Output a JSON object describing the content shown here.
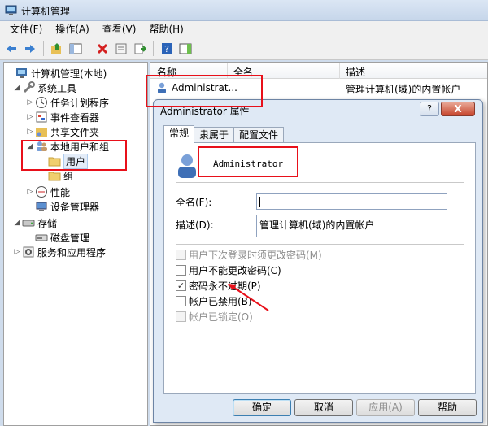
{
  "window": {
    "title": "计算机管理"
  },
  "menu": [
    "文件(F)",
    "操作(A)",
    "查看(V)",
    "帮助(H)"
  ],
  "tree": {
    "root": "计算机管理(本地)",
    "system_tools": "系统工具",
    "task_scheduler": "任务计划程序",
    "event_viewer": "事件查看器",
    "shared_folders": "共享文件夹",
    "local_users_groups": "本地用户和组",
    "users": "用户",
    "groups": "组",
    "performance": "性能",
    "device_manager": "设备管理器",
    "storage": "存储",
    "disk_management": "磁盘管理",
    "services_apps": "服务和应用程序"
  },
  "list": {
    "columns": [
      "名称",
      "全名",
      "描述"
    ],
    "row": {
      "name": "Administrat...",
      "desc": "管理计算机(域)的内置帐户"
    }
  },
  "dialog": {
    "title": "Administrator 属性",
    "help": "?",
    "close": "X",
    "tabs": [
      "常规",
      "隶属于",
      "配置文件"
    ],
    "username": "Administrator",
    "full_name_label": "全名(F):",
    "full_name_value": "",
    "description_label": "描述(D):",
    "description_value": "管理计算机(域)的内置帐户",
    "options": [
      {
        "label": "用户下次登录时须更改密码(M)",
        "checked": false,
        "disabled": true
      },
      {
        "label": "用户不能更改密码(C)",
        "checked": false,
        "disabled": false
      },
      {
        "label": "密码永不过期(P)",
        "checked": true,
        "disabled": false
      },
      {
        "label": "帐户已禁用(B)",
        "checked": false,
        "disabled": false
      },
      {
        "label": "帐户已锁定(O)",
        "checked": false,
        "disabled": true
      }
    ],
    "buttons": {
      "ok": "确定",
      "cancel": "取消",
      "apply": "应用(A)",
      "help": "帮助"
    }
  },
  "colors": {
    "highlight": "#e8101a",
    "titlebar": "#c6d6ea",
    "dialog_bg": "#dfe9f5"
  }
}
